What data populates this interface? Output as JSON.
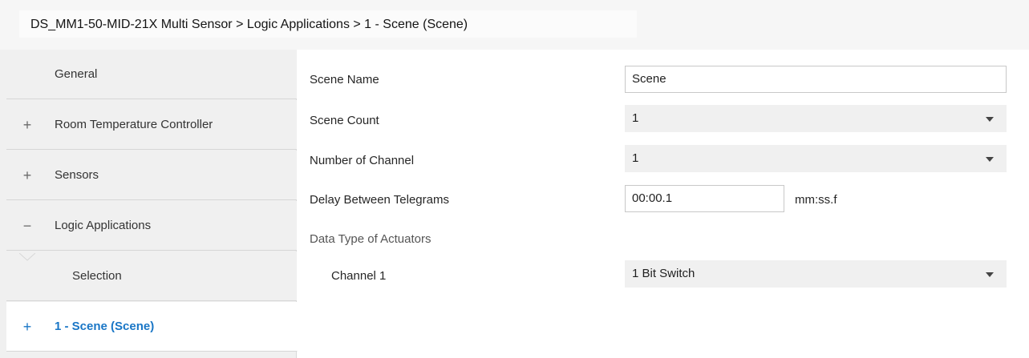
{
  "breadcrumb": "DS_MM1-50-MID-21X Multi Sensor > Logic Applications > 1 - Scene (Scene)",
  "sidebar": {
    "items": [
      {
        "symbol": "",
        "label": "General"
      },
      {
        "symbol": "+",
        "label": "Room Temperature Controller"
      },
      {
        "symbol": "+",
        "label": "Sensors"
      },
      {
        "symbol": "−",
        "label": "Logic Applications"
      },
      {
        "symbol": "",
        "label": "Selection"
      },
      {
        "symbol": "+",
        "label": "1 - Scene (Scene)"
      }
    ]
  },
  "form": {
    "scene_name": {
      "label": "Scene Name",
      "value": "Scene"
    },
    "scene_count": {
      "label": "Scene Count",
      "value": "1"
    },
    "number_of_channel": {
      "label": "Number of Channel",
      "value": "1"
    },
    "delay": {
      "label": "Delay Between Telegrams",
      "value": "00:00.1",
      "unit": "mm:ss.f"
    },
    "section_label": "Data Type of Actuators",
    "channel1": {
      "label": "Channel 1",
      "value": "1 Bit Switch"
    }
  },
  "colors": {
    "accent": "#1976c6",
    "sidebar_bg": "#f0f0f0",
    "select_bg": "#f0f0f0"
  },
  "icons": {
    "expand": "plus-icon",
    "collapse": "minus-icon",
    "dropdown": "chevron-down-icon"
  }
}
